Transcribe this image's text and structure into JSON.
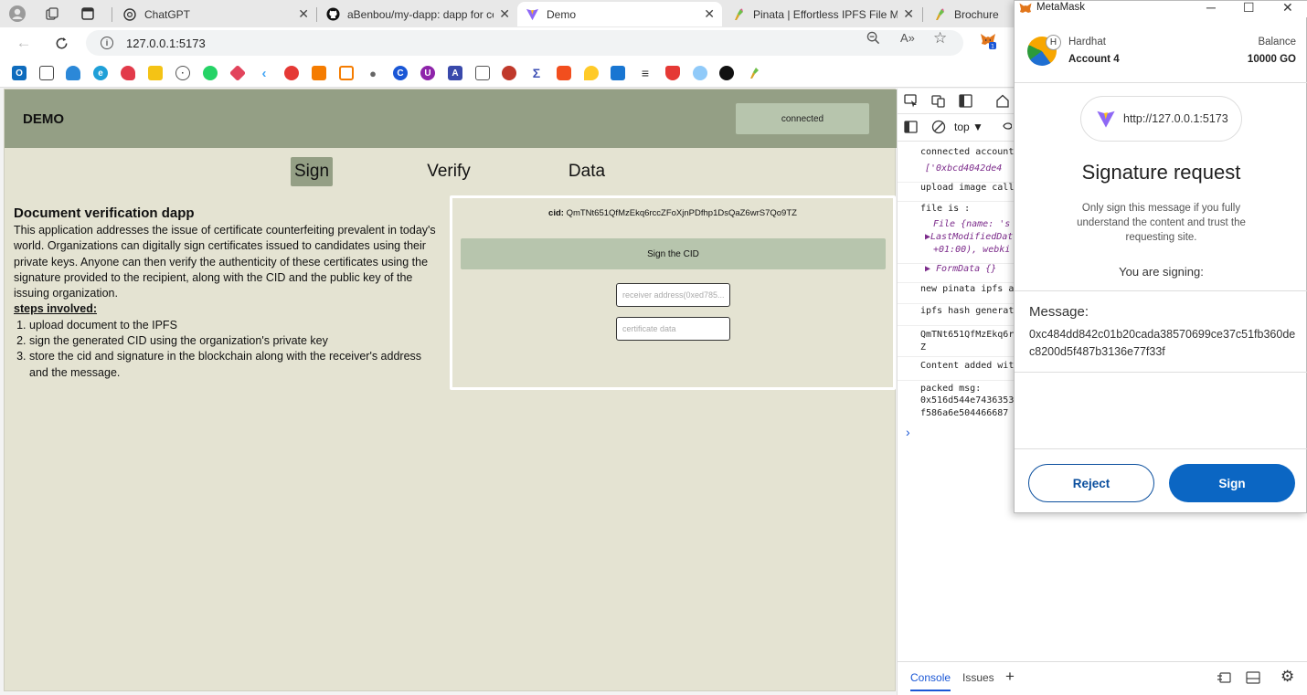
{
  "browser": {
    "tabs": [
      {
        "label": "ChatGPT",
        "icon": "chatgpt-icon"
      },
      {
        "label": "aBenbou/my-dapp: dapp for cer",
        "icon": "github-icon"
      },
      {
        "label": "Demo",
        "icon": "vite-icon",
        "active": true
      },
      {
        "label": "Pinata | Effortless IPFS File Mana",
        "icon": "pinata-icon"
      },
      {
        "label": "Brochure",
        "icon": "pinata-icon"
      }
    ],
    "url": "127.0.0.1:5173"
  },
  "app": {
    "title": "DEMO",
    "connect_status": "connected",
    "nav": [
      "Sign",
      "Verify",
      "Data"
    ],
    "description": {
      "heading": "Document verification dapp",
      "body": "This application addresses the issue of certificate counterfeiting prevalent in today's world. Organizations can digitally sign certificates issued to candidates using their private keys. Anyone can then verify the authenticity of these certificates using the signature provided to the recipient, along with the CID and the public key of the issuing organization.",
      "steps_title": "steps involved:",
      "steps": [
        "upload document to the IPFS",
        "sign the generated CID using the organization's private key",
        "store the cid and signature in the blockchain along with the receiver's address and the message."
      ]
    },
    "sign_panel": {
      "cid_label": "cid:",
      "cid_value": "QmTNt651QfMzEkq6rccZFoXjnPDfhp1DsQaZ6wrS7Qo9TZ",
      "sign_button": "Sign the CID",
      "receiver_placeholder": "receiver address(0xed785...",
      "data_placeholder": "certificate data"
    }
  },
  "devtools": {
    "context": "top",
    "logs": [
      "connected account",
      "['0xbcd4042de4",
      "upload image call",
      "file is :",
      "File {name: 's",
      "▶LastModifiedDat",
      "+01:00), webki",
      "▶ FormData {}",
      "new pinata ipfs a",
      "ipfs hash generat",
      "QmTNt651QfMzEkq6r",
      "Z",
      "Content added wit",
      "packed msg:",
      "0x516d544e7436353",
      "f586a6e504466687"
    ],
    "bottom_tabs": [
      "Console",
      "Issues"
    ]
  },
  "metamask": {
    "window_title": "MetaMask",
    "network": "Hardhat",
    "account": "Account 4",
    "balance_label": "Balance",
    "balance": "10000 GO",
    "origin": "http://127.0.0.1:5173",
    "heading": "Signature request",
    "warning": "Only sign this message if you fully understand the content and trust the requesting site.",
    "signing_label": "You are signing:",
    "message_label": "Message:",
    "message": "0xc484dd842c01b20cada38570699ce37c51fb360dec8200d5f487b3136e77f33f",
    "reject": "Reject",
    "sign": "Sign"
  }
}
